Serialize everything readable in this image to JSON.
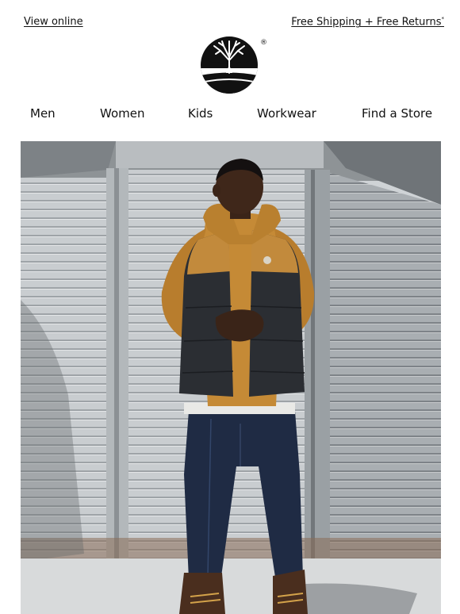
{
  "header": {
    "view_online": "View online",
    "shipping_promo": "Free Shipping + Free Returns",
    "shipping_mark": "*"
  },
  "brand": {
    "logo_icon": "tree-logo-icon",
    "registered_mark": "®"
  },
  "nav": {
    "items": [
      {
        "label": "Men"
      },
      {
        "label": "Women"
      },
      {
        "label": "Kids"
      },
      {
        "label": "Workwear"
      },
      {
        "label": "Find a Store"
      }
    ]
  },
  "hero": {
    "image_icon": "hero-photo"
  },
  "colors": {
    "background": "#ffffff",
    "text": "#111111",
    "wheat": "#c58a36",
    "vest_dark": "#2b2e33",
    "denim": "#1f2b44"
  }
}
